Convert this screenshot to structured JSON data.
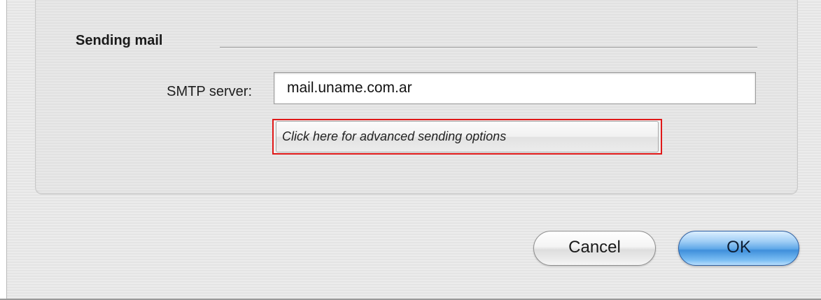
{
  "section": {
    "title": "Sending mail"
  },
  "smtp": {
    "label": "SMTP server:",
    "value": "mail.uname.com.ar"
  },
  "advanced_button": {
    "label": "Click here for advanced sending options",
    "highlight_color": "#e01818"
  },
  "buttons": {
    "cancel_label": "Cancel",
    "ok_label": "OK",
    "default_color": "#5fa8e8"
  }
}
